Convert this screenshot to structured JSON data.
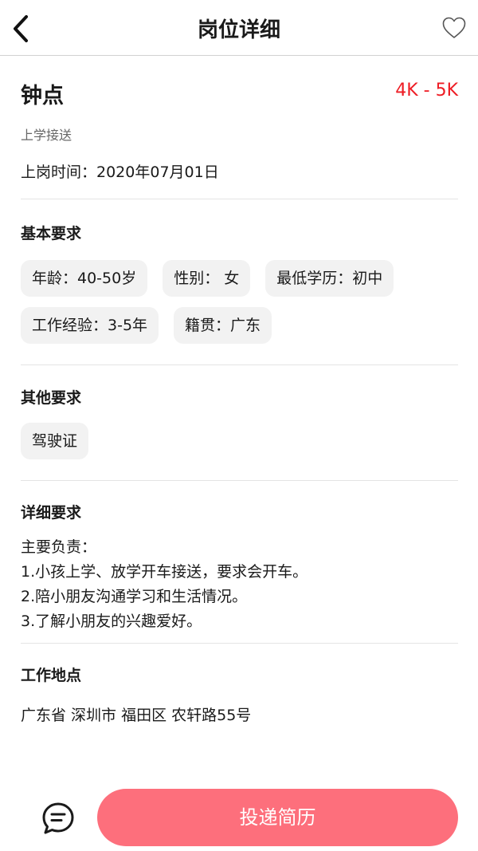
{
  "nav": {
    "title": "岗位详细",
    "back_icon": "chevron-left-icon",
    "favorite_icon": "heart-outline-icon"
  },
  "job": {
    "name": "钟点",
    "salary": "4K - 5K",
    "subtitle": "上学接送",
    "start_time": "上岗时间：2020年07月01日"
  },
  "basic": {
    "title": "基本要求",
    "tags": [
      "年龄：40-50岁",
      "性别： 女",
      "最低学历：初中",
      "工作经验：3-5年",
      "籍贯：广东"
    ]
  },
  "other": {
    "title": "其他要求",
    "tags": [
      "驾驶证"
    ]
  },
  "detail": {
    "title": "详细要求",
    "lines": [
      "主要负责：",
      "1.小孩上学、放学开车接送，要求会开车。",
      "2.陪小朋友沟通学习和生活情况。",
      "3.了解小朋友的兴趣爱好。"
    ]
  },
  "location": {
    "title": "工作地点",
    "address": "广东省 深圳市 福田区 农轩路55号"
  },
  "bottom": {
    "chat_icon": "chat-bubble-icon",
    "apply_label": "投递简历"
  },
  "colors": {
    "salary": "#ee1c24",
    "apply_button": "#fd6f7c",
    "tag_bg": "#f2f2f2"
  }
}
